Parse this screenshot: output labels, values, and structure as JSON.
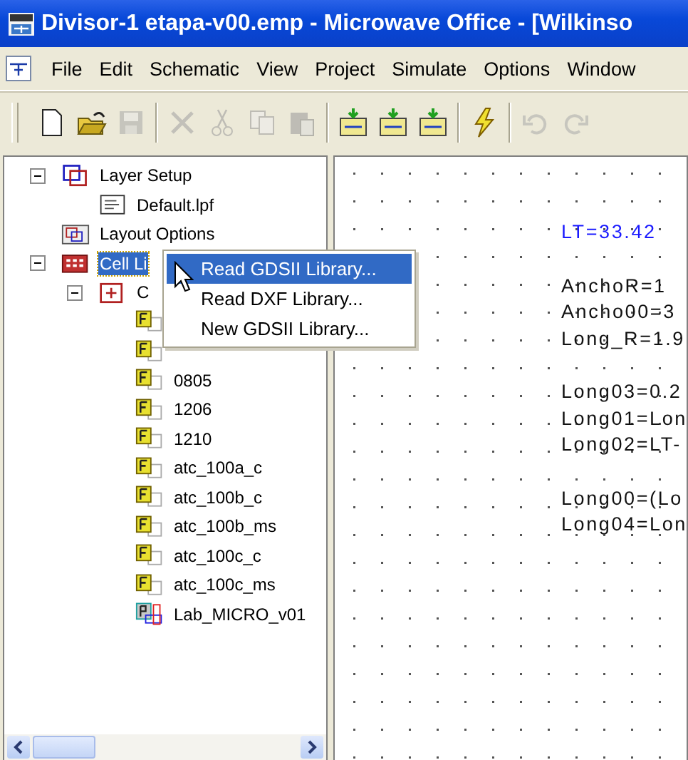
{
  "window": {
    "title": "Divisor-1 etapa-v00.emp - Microwave Office - [Wilkinso"
  },
  "menu_bar": [
    "File",
    "Edit",
    "Schematic",
    "View",
    "Project",
    "Simulate",
    "Options",
    "Window"
  ],
  "toolbar": [
    {
      "kind": "new",
      "disabled": false
    },
    {
      "kind": "open",
      "disabled": false
    },
    {
      "kind": "save",
      "disabled": true
    },
    {
      "kind": "sep"
    },
    {
      "kind": "delete",
      "disabled": true
    },
    {
      "kind": "cut",
      "disabled": true
    },
    {
      "kind": "copy",
      "disabled": true
    },
    {
      "kind": "paste",
      "disabled": true
    },
    {
      "kind": "sep"
    },
    {
      "kind": "add-schematic",
      "disabled": false
    },
    {
      "kind": "add-subcircuit",
      "disabled": false
    },
    {
      "kind": "add-graph",
      "disabled": false
    },
    {
      "kind": "sep"
    },
    {
      "kind": "simulate",
      "disabled": false
    },
    {
      "kind": "sep"
    },
    {
      "kind": "undo",
      "disabled": true
    },
    {
      "kind": "redo",
      "disabled": true
    }
  ],
  "tree": [
    {
      "label": "Layer Setup",
      "kind": "layers",
      "expanded": true,
      "selected": false,
      "children": [
        {
          "label": "Default.lpf",
          "kind": "file",
          "selected": false
        }
      ]
    },
    {
      "label": "Layout Options",
      "kind": "layout-options",
      "selected": false
    },
    {
      "label": "Cell Li",
      "kind": "cell-library",
      "expanded": true,
      "selected": true,
      "children": [
        {
          "label": "C",
          "kind": "cell-group",
          "expanded": true,
          "selected": false,
          "children": [
            {
              "kind": "footprint",
              "selected": false
            },
            {
              "kind": "footprint",
              "selected": false
            },
            {
              "label": "0805",
              "kind": "footprint",
              "selected": false
            },
            {
              "label": "1206",
              "kind": "footprint",
              "selected": false
            },
            {
              "label": "1210",
              "kind": "footprint",
              "selected": false
            },
            {
              "label": "atc_100a_c",
              "kind": "footprint",
              "selected": false
            },
            {
              "label": "atc_100b_c",
              "kind": "footprint",
              "selected": false
            },
            {
              "label": "atc_100b_ms",
              "kind": "footprint",
              "selected": false
            },
            {
              "label": "atc_100c_c",
              "kind": "footprint",
              "selected": false
            },
            {
              "label": "atc_100c_ms",
              "kind": "footprint",
              "selected": false
            },
            {
              "label": "Lab_MICRO_v01",
              "kind": "part",
              "selected": false
            }
          ]
        }
      ]
    }
  ],
  "context_menu": [
    {
      "label": "Read GDSII Library...",
      "selected": true
    },
    {
      "label": "Read DXF Library...",
      "selected": false
    },
    {
      "label": "New GDSII Library...",
      "selected": false
    }
  ],
  "canvas": {
    "groups": [
      {
        "lines": [
          {
            "text": "LT=33.42",
            "kind": "highlighted"
          }
        ]
      },
      {
        "lines": [
          {
            "text": "AnchoR=1",
            "kind": "normal"
          },
          {
            "text": "Ancho00=3",
            "kind": "normal"
          },
          {
            "text": "Long_R=1.9",
            "kind": "normal"
          }
        ]
      },
      {
        "lines": [
          {
            "text": "Long03=0.2",
            "kind": "normal"
          },
          {
            "text": "Long01=Lon",
            "kind": "normal"
          },
          {
            "text": "Long02=LT-",
            "kind": "normal"
          }
        ]
      },
      {
        "lines": [
          {
            "text": "Long00=(Lo",
            "kind": "normal"
          },
          {
            "text": "Long04=Lon",
            "kind": "normal"
          }
        ]
      }
    ]
  }
}
